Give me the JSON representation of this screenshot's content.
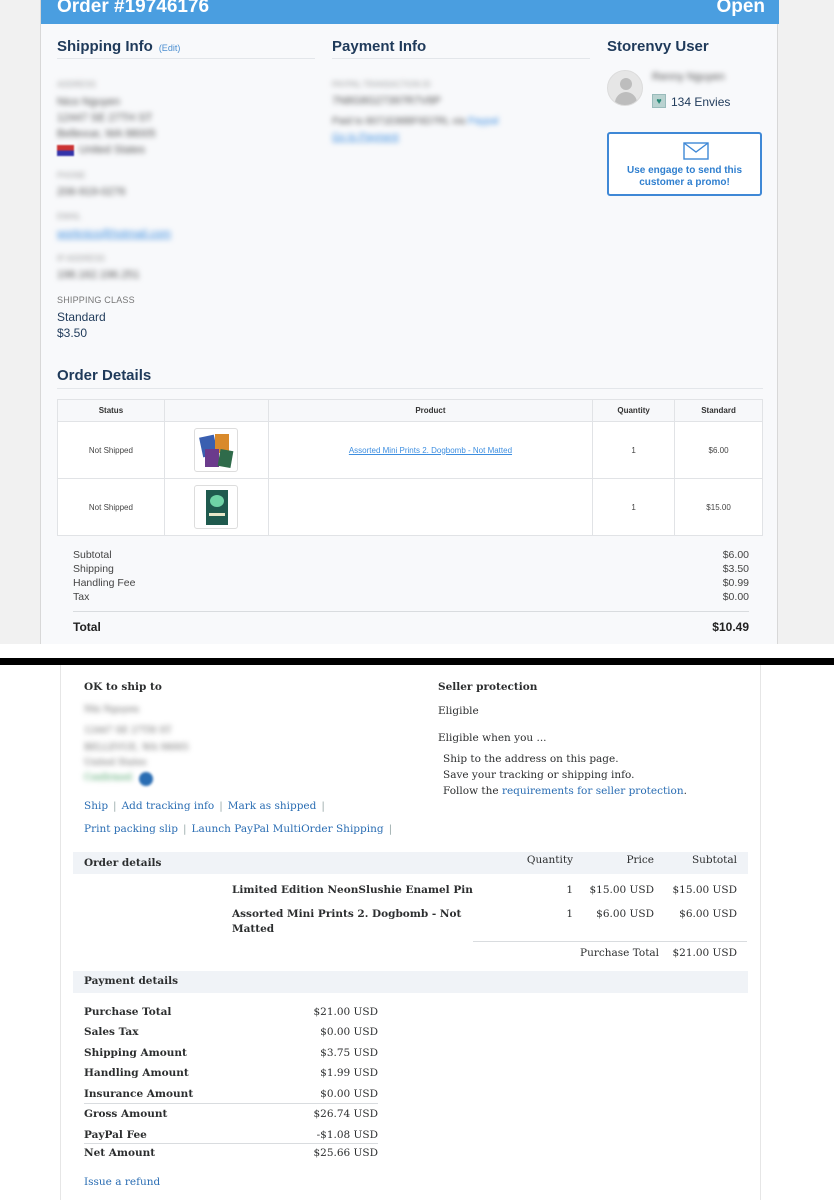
{
  "storenvy": {
    "order_title": "Order #19746176",
    "order_status": "Open",
    "shipping_info": {
      "title": "Shipping Info",
      "edit_label": "(Edit)",
      "address_label": "ADDRESS",
      "address_lines": [
        "Nico Nguyen",
        "12447 SE 27TH ST",
        "Bellevue, WA 98005",
        "United States"
      ],
      "phone_label": "PHONE",
      "phone": "206-919-0276",
      "email_label": "EMAIL",
      "email": "worknico@hotmail.com",
      "ip_label": "IP ADDRESS",
      "ip": "198.162.196.251",
      "shipping_class_label": "SHIPPING CLASS",
      "shipping_class": "Standard",
      "shipping_price": "$3.50"
    },
    "payment_info": {
      "title": "Payment Info",
      "txn_label": "PAYPAL TRANSACTION ID",
      "txn_id": "7N8G8G27397R7V8P",
      "paid_line": "Paid to 8071E88BF6D7RL via",
      "paypal_word": "Paypal",
      "goto_link": "Go to Payment"
    },
    "storenvy_user": {
      "title": "Storenvy User",
      "username": "Renny Nguyen",
      "envies": "134 Envies",
      "promo_text": "Use engage to send this customer a promo!"
    },
    "order_details": {
      "title": "Order Details",
      "columns": [
        "Status",
        "",
        "Product",
        "Quantity",
        "Standard"
      ],
      "rows": [
        {
          "status": "Not Shipped",
          "product": "Assorted Mini Prints 2. Dogbomb - Not Matted",
          "quantity": "1",
          "price": "$6.00"
        },
        {
          "status": "Not Shipped",
          "product": "",
          "quantity": "1",
          "price": "$15.00"
        }
      ],
      "totals": [
        {
          "label": "Subtotal",
          "value": "$6.00"
        },
        {
          "label": "Shipping",
          "value": "$3.50"
        },
        {
          "label": "Handling Fee",
          "value": "$0.99"
        },
        {
          "label": "Tax",
          "value": "$0.00"
        }
      ],
      "total_label": "Total",
      "total_value": "$10.49"
    }
  },
  "paypal": {
    "ok_to_ship": {
      "title": "OK to ship to",
      "address_lines": [
        "Nhi Nguyen",
        "12447 SE 27TH ST",
        "BELLEVUE, WA 98005",
        "United States",
        "Confirmed"
      ]
    },
    "actions_row1": [
      "Ship",
      "Add tracking info",
      "Mark as shipped"
    ],
    "actions_row2": [
      "Print packing slip",
      "Launch PayPal MultiOrder Shipping"
    ],
    "seller_protection": {
      "title": "Seller protection",
      "status": "Eligible",
      "when": "Eligible when you ...",
      "item1": "Ship to the address on this page.",
      "item2": "Save your tracking or shipping info.",
      "item3_prefix": "Follow the ",
      "item3_link": "requirements for seller protection",
      "item3_suffix": "."
    },
    "order_details": {
      "title": "Order details",
      "col_quantity": "Quantity",
      "col_price": "Price",
      "col_subtotal": "Subtotal",
      "items": [
        {
          "name_line1": "Limited Edition NeonSlushie Enamel Pin",
          "name_line2": "",
          "quantity": "1",
          "price": "$15.00 USD",
          "subtotal": "$15.00 USD"
        },
        {
          "name_line1": "Assorted Mini Prints 2. Dogbomb - Not",
          "name_line2": "Matted",
          "quantity": "1",
          "price": "$6.00 USD",
          "subtotal": "$6.00 USD"
        }
      ],
      "purchase_total_label": "Purchase Total",
      "purchase_total_value": "$21.00 USD"
    },
    "payment_details": {
      "title": "Payment details",
      "rows": [
        {
          "label": "Purchase Total",
          "value": "$21.00 USD"
        },
        {
          "label": "Sales Tax",
          "value": "$0.00 USD"
        },
        {
          "label": "Shipping Amount",
          "value": "$3.75 USD"
        },
        {
          "label": "Handling Amount",
          "value": "$1.99 USD"
        },
        {
          "label": "Insurance Amount",
          "value": "$0.00 USD"
        },
        {
          "label": "Gross Amount",
          "value": "$26.74 USD"
        },
        {
          "label": "PayPal Fee",
          "value": "-$1.08 USD"
        },
        {
          "label": "Net Amount",
          "value": "$25.66 USD"
        }
      ]
    },
    "issue_refund": "Issue a refund"
  },
  "colors": {
    "storenvy_blue": "#4a9ee0",
    "link_blue": "#3d8ee0",
    "heading_navy": "#1f3a5a",
    "paypal_link": "#2a6db3"
  }
}
